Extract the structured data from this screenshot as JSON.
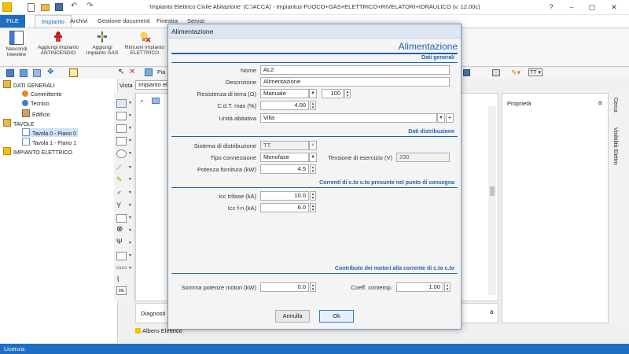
{
  "window": {
    "title": "'Impianto Elettrico Civile Abitazione' (C:\\ACCA) - Impiantus-FUOCO+GAS+ELETTRICO+RIVELATORI+IDRAULICO (v. 12.00c)"
  },
  "ribbon_tabs": [
    "FILE",
    "Impianto",
    "Archivi",
    "Gestione documenti",
    "Finestra",
    "Servizi"
  ],
  "ribbon_buttons": [
    {
      "line1": "Nascondi",
      "line2": "treeview",
      "icon": "treeview-icon"
    },
    {
      "line1": "Aggiungi Impianto",
      "line2": "ANTINCENDIO",
      "icon": "hydrant-icon"
    },
    {
      "line1": "Aggiungi",
      "line2": "Impianto GAS",
      "icon": "gas-icon"
    },
    {
      "line1": "Rimuovi Impianto",
      "line2": "ELETTRICO",
      "icon": "remove-bulb-icon"
    }
  ],
  "tree": {
    "items": [
      {
        "label": "DATI GENERALI",
        "level": 0,
        "icon": "folder-icon"
      },
      {
        "label": "Committente",
        "level": 1,
        "icon": "person-icon"
      },
      {
        "label": "Tecnico",
        "level": 1,
        "icon": "person-icon"
      },
      {
        "label": "Edificio",
        "level": 1,
        "icon": "building-icon"
      },
      {
        "label": "TAVOLE",
        "level": 0,
        "icon": "folder-icon"
      },
      {
        "label": "Tavola 0 - Piano 0",
        "level": 1,
        "icon": "sheet-icon"
      },
      {
        "label": "Tavola 1 - Piano 1",
        "level": 1,
        "icon": "sheet-icon"
      },
      {
        "label": "IMPIANTO ELETTRICO",
        "level": 0,
        "icon": "electric-icon"
      }
    ]
  },
  "workspace": {
    "toolbar_label": "Pia",
    "vista_label": "Vista",
    "vista_value": "Impianto ele",
    "diagnostic_label": "Diagnosti",
    "bottom_tab": "Albero Elettrico",
    "properties_title": "Proprietà",
    "properties_pin": "a",
    "right_tabs": [
      "Cerca",
      "Visibilità Elettro"
    ]
  },
  "statusbar": {
    "text": "Licenza:"
  },
  "dialog": {
    "window_title": "Alimentazione",
    "heading": "Alimentazione",
    "sections": {
      "general": "Dati generali",
      "distribution": "Dati distribuzione",
      "short_circuit": "Correnti di c.to c.to presunte nel punto di consegna",
      "motors": "Contributo dei motori alla corrente di c.to c.to"
    },
    "fields": {
      "nome": {
        "label": "Nome",
        "value": "AL2"
      },
      "descrizione": {
        "label": "Descrizione",
        "value": "Alimentazione"
      },
      "resistenza": {
        "label": "Resistenza di terra (Ω)",
        "value": "Manuale",
        "extra": "100"
      },
      "cdt": {
        "label": "C.d.T. max (%)",
        "value": "4.00"
      },
      "unita": {
        "label": "Unità abitativa",
        "value": "Villa",
        "plus": "+"
      },
      "sistema": {
        "label": "Sistema di distribuzione",
        "value": "TT"
      },
      "tipo": {
        "label": "Tipo connessione",
        "value": "Monofase"
      },
      "tensione": {
        "label": "Tensione di esercizio (V)",
        "value": "230"
      },
      "potenza": {
        "label": "Potenza fornitura (kW)",
        "value": "4.5"
      },
      "icc_trifase": {
        "label": "Icc trifase (kA)",
        "value": "10.0"
      },
      "icc_fn": {
        "label": "Icc f-n (kA)",
        "value": "6.0"
      },
      "somma": {
        "label": "Somma potenze motori  (kW)",
        "value": "0.0"
      },
      "coeff": {
        "label": "Coeff. contemp.",
        "value": "1.00"
      }
    },
    "buttons": {
      "cancel": "Annulla",
      "ok": "Ok"
    }
  },
  "colors": {
    "accent": "#1e6fc4",
    "heading": "#2161b3"
  }
}
